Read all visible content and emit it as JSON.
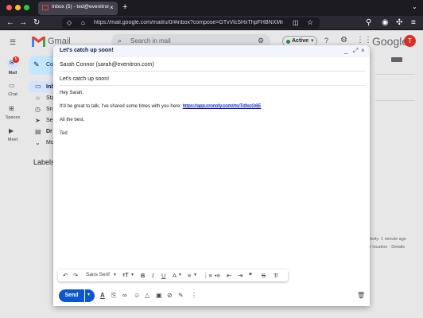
{
  "browser": {
    "tab_title": "Inbox (5) - ted@evenitron.com",
    "url": "https://mail.google.com/mail/u/0/#inbox?compose=GTvVlcSHxThpFHBNXMmvgDncpWFMv..."
  },
  "gmail": {
    "logo_text": "Gmail",
    "search_placeholder": "Search in mail",
    "status": "Active",
    "google_word": "Google",
    "avatar_initial": "T",
    "mail_badge": "5",
    "rail": {
      "mail": "Mail",
      "chat": "Chat",
      "spaces": "Spaces",
      "meet": "Meet"
    },
    "compose_label": "Co",
    "nav": [
      "Inb",
      "Sta",
      "Sn",
      "Se",
      "Dr",
      "Mo"
    ],
    "labels_heading": "Labels",
    "activity": "tivity: 1 minute ago",
    "location": "r location · Details"
  },
  "compose": {
    "title": "Let's catch up soon!",
    "to": "Sarah Connor (sarah@evenitron.com)",
    "subject": "Let's catch up soon!",
    "body": {
      "greeting": "Hey Sarah,",
      "line1_prefix": "It'd be great to talk, I've shared some times with you here: ",
      "link": "https://app.cronofy.com/rts/TdfxcG6E",
      "signoff": "All the best,",
      "signature": "Ted"
    },
    "font": "Sans Serif",
    "send_label": "Send"
  },
  "colors": {
    "send_blue": "#0b57d0",
    "header_bg": "#f2f6fc",
    "compose_pill": "#c2e7ff",
    "avatar_red": "#d93025"
  }
}
